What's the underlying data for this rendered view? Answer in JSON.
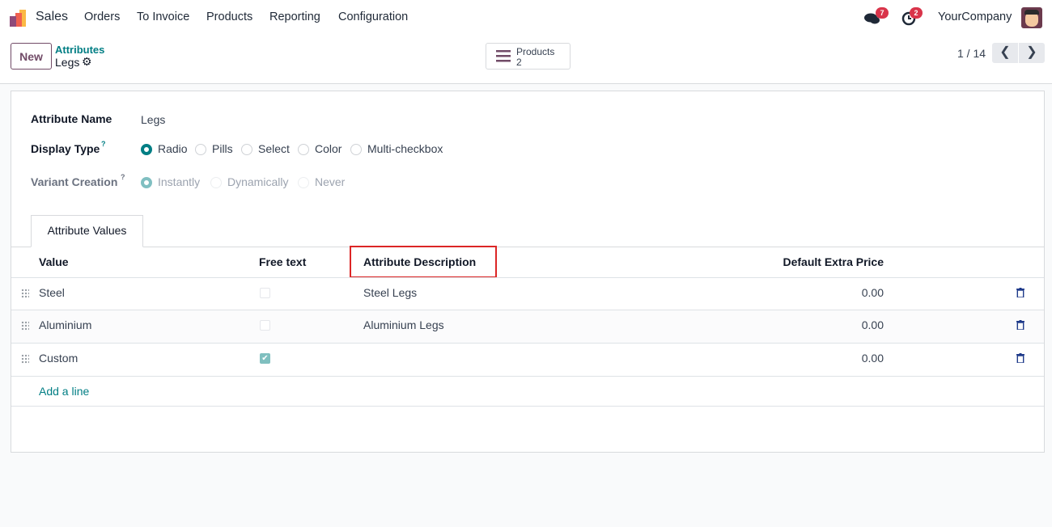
{
  "navbar": {
    "app_name": "Sales",
    "menu": [
      "Orders",
      "To Invoice",
      "Products",
      "Reporting",
      "Configuration"
    ],
    "messages_count": "7",
    "activities_count": "2",
    "company": "YourCompany"
  },
  "control_panel": {
    "new_label": "New",
    "breadcrumb_parent": "Attributes",
    "breadcrumb_current": "Legs",
    "smart_button_label": "Products",
    "smart_button_count": "2",
    "pager": "1 / 14"
  },
  "form": {
    "attribute_name_label": "Attribute Name",
    "attribute_name_value": "Legs",
    "display_type_label": "Display Type",
    "display_type_help": "?",
    "display_type_options": [
      "Radio",
      "Pills",
      "Select",
      "Color",
      "Multi-checkbox"
    ],
    "display_type_selected": "Radio",
    "variant_creation_label": "Variant Creation",
    "variant_creation_help": "?",
    "variant_creation_options": [
      "Instantly",
      "Dynamically",
      "Never"
    ],
    "variant_creation_selected": "Instantly"
  },
  "tabs": [
    "Attribute Values"
  ],
  "table": {
    "headers": [
      "Value",
      "Free text",
      "Attribute Description",
      "Default Extra Price"
    ],
    "rows": [
      {
        "value": "Steel",
        "free_text": false,
        "description": "Steel Legs",
        "price": "0.00"
      },
      {
        "value": "Aluminium",
        "free_text": false,
        "description": "Aluminium Legs",
        "price": "0.00"
      },
      {
        "value": "Custom",
        "free_text": true,
        "description": "",
        "price": "0.00"
      }
    ],
    "add_line": "Add a line"
  },
  "colors": {
    "accent": "#017e84",
    "brand": "#714b67",
    "highlight": "#dc2626"
  }
}
